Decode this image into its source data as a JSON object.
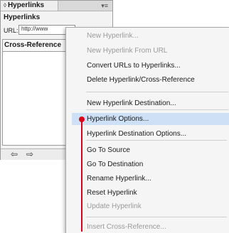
{
  "panel": {
    "tab_label": "Hyperlinks",
    "tab_arrows": "◊",
    "menu_icon": "▾≡",
    "title": "Hyperlinks",
    "url_label": "URL:",
    "url_value": "http://www",
    "list_header": "Cross-Reference",
    "nav_prev": "⇦",
    "nav_next": "⇨"
  },
  "menu": {
    "items": [
      {
        "label": "New Hyperlink...",
        "enabled": false
      },
      {
        "label": "New Hyperlink From URL",
        "enabled": false
      },
      {
        "label": "Convert URLs to Hyperlinks...",
        "enabled": true
      },
      {
        "label": "Delete Hyperlink/Cross-Reference",
        "enabled": true
      },
      {
        "label": "New Hyperlink Destination...",
        "enabled": true
      },
      {
        "label": "Hyperlink Options...",
        "enabled": true
      },
      {
        "label": "Hyperlink Destination Options...",
        "enabled": true
      },
      {
        "label": "Go To Source",
        "enabled": true
      },
      {
        "label": "Go To Destination",
        "enabled": true
      },
      {
        "label": "Rename Hyperlink...",
        "enabled": true
      },
      {
        "label": "Reset Hyperlink",
        "enabled": true
      },
      {
        "label": "Update Hyperlink",
        "enabled": false
      },
      {
        "label": "Insert Cross-Reference...",
        "enabled": false
      }
    ]
  },
  "colors": {
    "highlight": "#cde0f5",
    "callout": "#d6001c"
  }
}
